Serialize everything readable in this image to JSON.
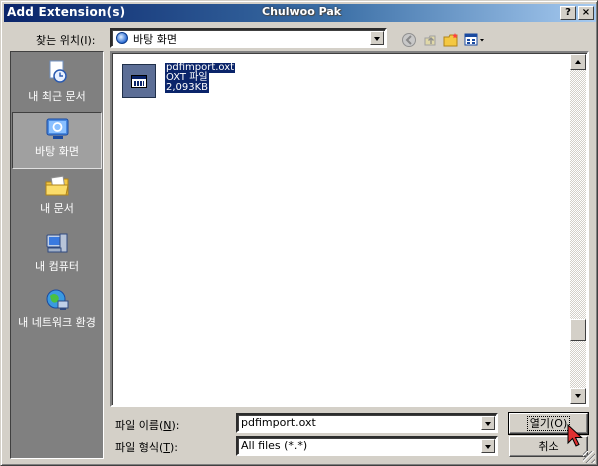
{
  "window": {
    "title": "Add Extension(s)",
    "overlay_text": "Chulwoo Pak",
    "help_button": "?",
    "close_button": "×"
  },
  "toolbar": {
    "lookin_label": "찾는 위치(I):",
    "lookin_value": "바탕 화면",
    "icons": [
      "back-icon",
      "up-folder-icon",
      "new-folder-icon",
      "views-menu-icon"
    ]
  },
  "places": [
    {
      "label": "내 최근 문서",
      "icon": "recent-documents-icon"
    },
    {
      "label": "바탕 화면",
      "icon": "desktop-icon",
      "selected": true
    },
    {
      "label": "내 문서",
      "icon": "my-documents-icon"
    },
    {
      "label": "내 컴퓨터",
      "icon": "my-computer-icon"
    },
    {
      "label": "내 네트워크 환경",
      "icon": "network-icon"
    }
  ],
  "files": [
    {
      "name": "pdfimport.oxt",
      "type": "OXT 파일",
      "size": "2,093KB",
      "selected": true
    }
  ],
  "form": {
    "filename_label_pre": "파일 이름(",
    "filename_label_key": "N",
    "filename_label_post": "):",
    "filename_value": "pdfimport.oxt",
    "filetype_label_pre": "파일 형식(",
    "filetype_label_key": "T",
    "filetype_label_post": "):",
    "filetype_value": "All files (*.*)",
    "open_button": "열기(O)",
    "cancel_button": "취소"
  },
  "colors": {
    "selection": "#0a246a",
    "titlebar_start": "#0a246a",
    "titlebar_end": "#a6caf0",
    "face": "#d4d0c8"
  }
}
